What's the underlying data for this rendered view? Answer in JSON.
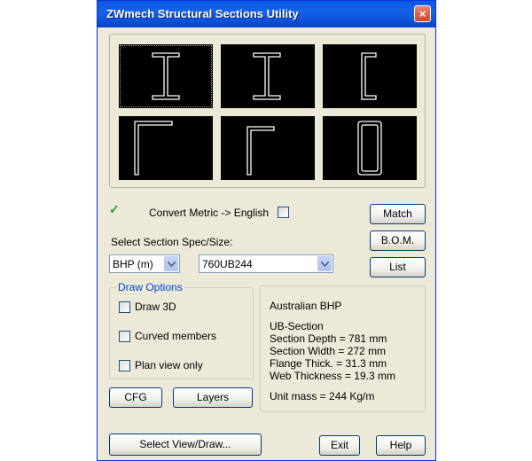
{
  "window": {
    "title": "ZWmech Structural Sections Utility",
    "close_glyph": "×"
  },
  "preview": {
    "tiles": [
      "i-section-large",
      "i-section",
      "channel-section",
      "angle-large",
      "angle-small",
      "rect-hollow-section"
    ],
    "selected_index": 0
  },
  "convert": {
    "label": "Convert Metric -> English",
    "left_checked": true,
    "right_checked": false
  },
  "select_label": "Select Section Spec/Size:",
  "spec_combo": {
    "value": "BHP (m)"
  },
  "size_combo": {
    "value": "760UB244"
  },
  "buttons": {
    "match": "Match",
    "bom": "B.O.M.",
    "list": "List",
    "cfg": "CFG",
    "layers": "Layers",
    "select_view": "Select View/Draw...",
    "exit": "Exit",
    "help": "Help"
  },
  "draw_options": {
    "title": "Draw Options",
    "items": [
      {
        "label": "Draw 3D",
        "checked": false
      },
      {
        "label": "Curved members",
        "checked": false
      },
      {
        "label": "Plan view only",
        "checked": false
      }
    ]
  },
  "info": {
    "standard": "Australian BHP",
    "section_type": "UB-Section",
    "depth": "Section Depth = 781 mm",
    "width": "Section Width = 272 mm",
    "flange": "Flange Thick. = 31.3 mm",
    "web": "Web Thickness = 19.3 mm",
    "mass": "Unit mass = 244 Kg/m"
  },
  "colors": {
    "title_bar": "#0a58e6",
    "dialog_bg": "#ece9d8",
    "group_title": "#0046d5",
    "check_green": "#21a121"
  }
}
